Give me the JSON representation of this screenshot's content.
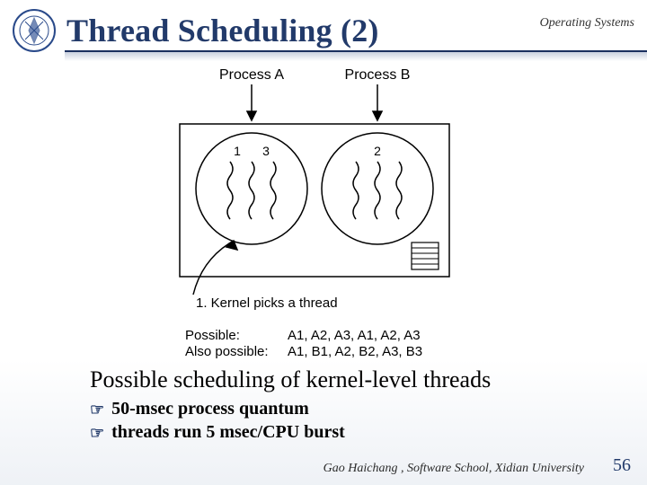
{
  "header": {
    "title": "Thread Scheduling (2)",
    "course_label": "Operating Systems"
  },
  "figure": {
    "process_a_label": "Process A",
    "process_b_label": "Process B",
    "thread_labels": {
      "a_left": "1",
      "a_right": "3",
      "b_center": "2"
    },
    "kernel_caption": "1. Kernel picks a thread",
    "possible_label": "Possible:",
    "possible_seq": "A1, A2, A3, A1, A2, A3",
    "also_possible_label": "Also possible:",
    "also_possible_seq": "A1, B1, A2, B2, A3, B3"
  },
  "caption": {
    "main": "Possible scheduling of kernel-level threads",
    "bullets": [
      "50-msec process quantum",
      "threads run 5 msec/CPU burst"
    ]
  },
  "footer": {
    "credit": "Gao Haichang , Software School, Xidian University",
    "page": "56"
  }
}
